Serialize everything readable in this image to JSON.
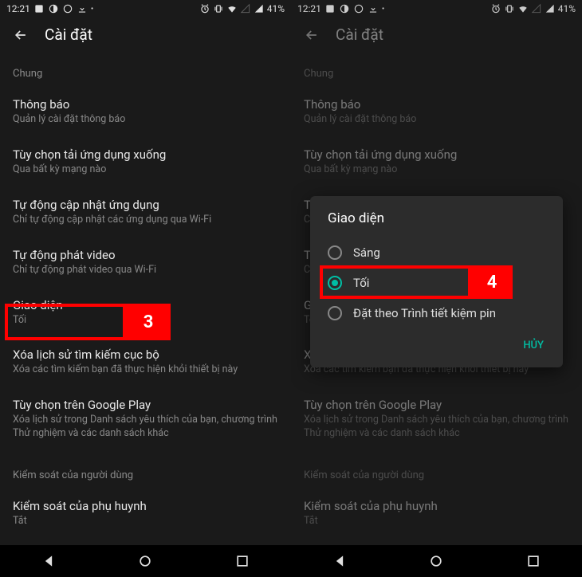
{
  "status": {
    "time": "12:21",
    "battery": "41%"
  },
  "header": {
    "title": "Cài đặt"
  },
  "section_general": "Chung",
  "items": {
    "notif": {
      "title": "Thông báo",
      "sub": "Quản lý cài đặt thông báo"
    },
    "dl": {
      "title": "Tùy chọn tải ứng dụng xuống",
      "sub": "Qua bất kỳ mạng nào"
    },
    "update": {
      "title": "Tự động cập nhật ứng dụng",
      "sub": "Chỉ tự động cập nhật các ứng dụng qua Wi-Fi"
    },
    "video": {
      "title": "Tự động phát video",
      "sub": "Chỉ tự động phát video qua Wi-Fi"
    },
    "theme": {
      "title": "Giao diện",
      "sub": "Tối"
    },
    "clear": {
      "title": "Xóa lịch sử tìm kiếm cục bộ",
      "sub": "Xóa các tìm kiếm bạn đã thực hiện khỏi thiết bị này"
    },
    "gplay": {
      "title": "Tùy chọn trên Google Play",
      "sub": "Xóa lịch sử trong Danh sách yêu thích của bạn, chương trình Thử nghiệm và các danh sách khác"
    }
  },
  "section_user": "Kiểm soát của người dùng",
  "parental": {
    "title": "Kiểm soát của phụ huynh",
    "sub": "Tắt"
  },
  "dialog": {
    "title": "Giao diện",
    "opt_light": "Sáng",
    "opt_dark": "Tối",
    "opt_saver": "Đặt theo Trình tiết kiệm pin",
    "cancel": "HỦY"
  },
  "annot": {
    "step3": "3",
    "step4": "4"
  }
}
